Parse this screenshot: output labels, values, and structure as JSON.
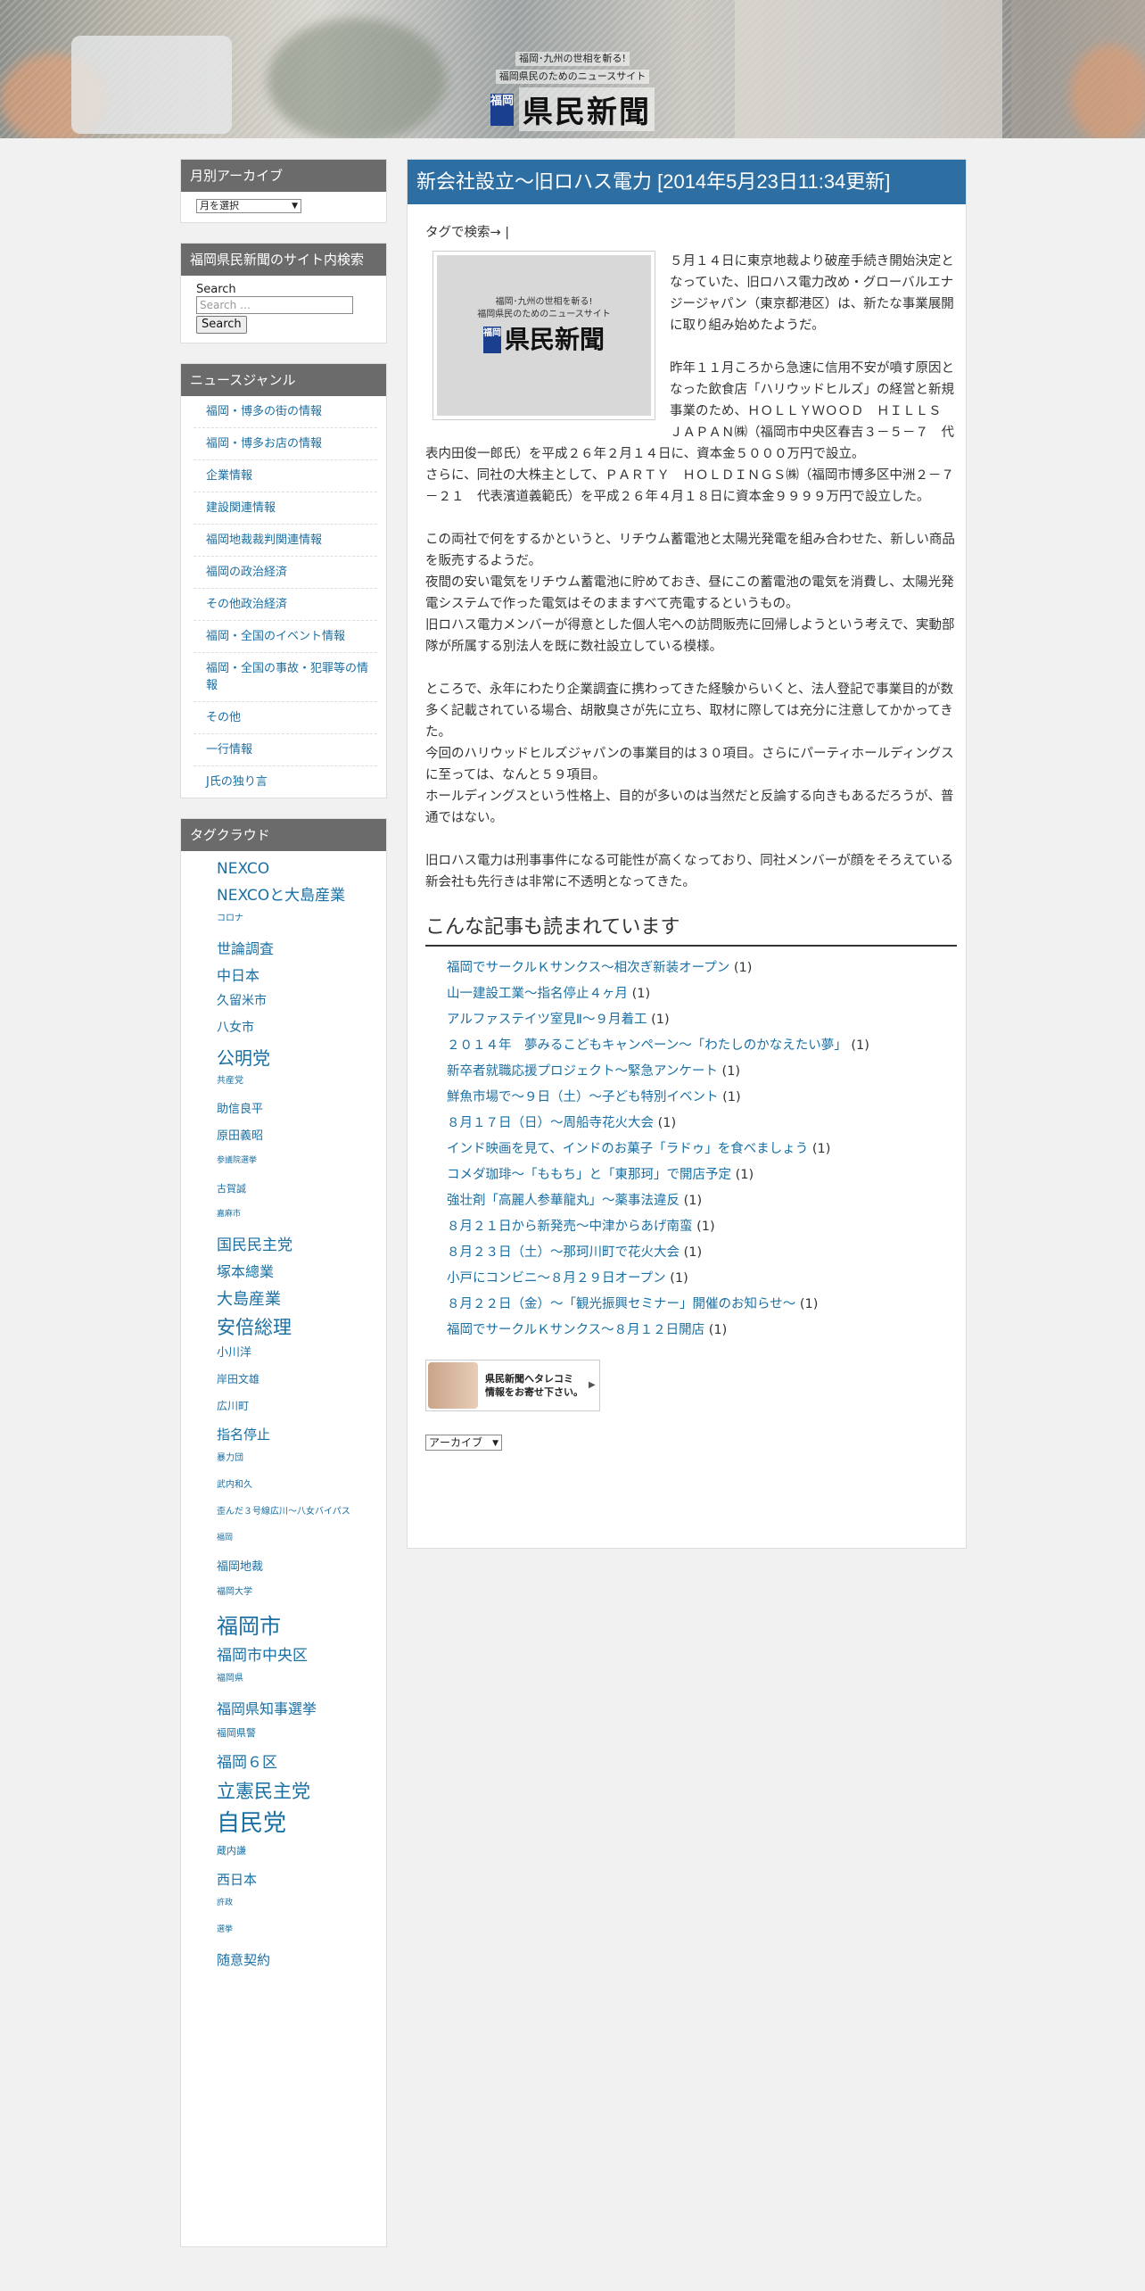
{
  "header": {
    "tagline1": "福岡･九州の世相を斬る!",
    "tagline2": "福岡県民のためのニュースサイト",
    "logo_mark": "福岡",
    "logo_text": "県民新聞"
  },
  "sidebar": {
    "archive": {
      "title": "月別アーカイブ",
      "select_value": "月を選択"
    },
    "search": {
      "title": "福岡県民新聞のサイト内検索",
      "label": "Search",
      "placeholder": "Search …",
      "button": "Search"
    },
    "genre": {
      "title": "ニュースジャンル",
      "items": [
        "福岡・博多の街の情報",
        "福岡・博多お店の情報",
        "企業情報",
        "建設関連情報",
        "福岡地裁裁判関連情報",
        "福岡の政治経済",
        "その他政治経済",
        "福岡・全国のイベント情報",
        "福岡・全国の事故・犯罪等の情報",
        "その他",
        "一行情報",
        "J氏の独り言"
      ]
    },
    "tagcloud": {
      "title": "タグクラウド",
      "tags": [
        {
          "t": "NEXCO",
          "s": 17
        },
        {
          "t": "NEXCOと大島産業",
          "s": 17
        },
        {
          "t": "コロナ",
          "s": 10
        },
        {
          "t": "世論調査",
          "s": 16
        },
        {
          "t": "中日本",
          "s": 16
        },
        {
          "t": "久留米市",
          "s": 14
        },
        {
          "t": "八女市",
          "s": 14
        },
        {
          "t": "公明党",
          "s": 20
        },
        {
          "t": "共産党",
          "s": 10
        },
        {
          "t": "助信良平",
          "s": 13
        },
        {
          "t": "原田義昭",
          "s": 13
        },
        {
          "t": "参議院選挙",
          "s": 9
        },
        {
          "t": "古賀誠",
          "s": 11
        },
        {
          "t": "嘉麻市",
          "s": 9
        },
        {
          "t": "国民民主党",
          "s": 17
        },
        {
          "t": "塚本總業",
          "s": 16
        },
        {
          "t": "大島産業",
          "s": 18
        },
        {
          "t": "安倍総理",
          "s": 21
        },
        {
          "t": "小川洋",
          "s": 13
        },
        {
          "t": "岸田文雄",
          "s": 12
        },
        {
          "t": "広川町",
          "s": 12
        },
        {
          "t": "指名停止",
          "s": 15
        },
        {
          "t": "暴力団",
          "s": 10
        },
        {
          "t": "武内和久",
          "s": 10
        },
        {
          "t": "歪んだ３号線広川～八女バイパス",
          "s": 10
        },
        {
          "t": "福岡",
          "s": 9
        },
        {
          "t": "福岡地裁",
          "s": 13
        },
        {
          "t": "福岡大学",
          "s": 10
        },
        {
          "t": "福岡市",
          "s": 24
        },
        {
          "t": "福岡市中央区",
          "s": 17
        },
        {
          "t": "福岡県",
          "s": 10
        },
        {
          "t": "福岡県知事選挙",
          "s": 16
        },
        {
          "t": "福岡県警",
          "s": 11
        },
        {
          "t": "福岡６区",
          "s": 17
        },
        {
          "t": "立憲民主党",
          "s": 21
        },
        {
          "t": "自民党",
          "s": 26
        },
        {
          "t": "蔵内謙",
          "s": 11
        },
        {
          "t": "西日本",
          "s": 15
        },
        {
          "t": "許政",
          "s": 9
        },
        {
          "t": "選挙",
          "s": 9
        },
        {
          "t": "随意契約",
          "s": 15
        }
      ]
    }
  },
  "post": {
    "title": "新会社設立～旧ロハス電力 [2014年5月23日11:34更新]",
    "tag_search": "タグで検索→ |",
    "thumb": {
      "line1": "福岡･九州の世相を斬る!",
      "line2": "福岡県民のためのニュースサイト",
      "mark": "福岡",
      "text": "県民新聞"
    },
    "paragraphs": [
      "５月１４日に東京地裁より破産手続き開始決定となっていた、旧ロハス電力改め・グローバルエナジージャパン（東京都港区）は、新たな事業展開に取り組み始めたようだ。",
      "昨年１１月ころから急速に信用不安が噴す原因となった飲食店「ハリウッドヒルズ」の経営と新規事業のため、ＨＯＬＬＹＷＯＯＤ　ＨＩＬＬＳ　ＪＡＰＡＮ㈱（福岡市中央区春吉３－５－７　代表内田俊一郎氏）を平成２６年２月１４日に、資本金５０００万円で設立。\nさらに、同社の大株主として、ＰＡＲＴＹ　ＨＯＬＤＩＮＧＳ㈱（福岡市博多区中洲２－７－２１　代表濱道義範氏）を平成２６年４月１８日に資本金９９９９万円で設立した。",
      "この両社で何をするかというと、リチウム蓄電池と太陽光発電を組み合わせた、新しい商品を販売するようだ。\n夜間の安い電気をリチウム蓄電池に貯めておき、昼にこの蓄電池の電気を消費し、太陽光発電システムで作った電気はそのまますべて売電するというもの。\n旧ロハス電力メンバーが得意とした個人宅への訪問販売に回帰しようという考えで、実動部隊が所属する別法人を既に数社設立している模様。",
      "ところで、永年にわたり企業調査に携わってきた経験からいくと、法人登記で事業目的が数多く記載されている場合、胡散臭さが先に立ち、取材に際しては充分に注意してかかってきた。\n今回のハリウッドヒルズジャパンの事業目的は３０項目。さらにパーティホールディングスに至っては、なんと５９項目。\nホールディングスという性格上、目的が多いのは当然だと反論する向きもあるだろうが、普通ではない。",
      "旧ロハス電力は刑事事件になる可能性が高くなっており、同社メンバーが顔をそろえている新会社も先行きは非常に不透明となってきた。"
    ],
    "related_title": "こんな記事も読まれています",
    "related": [
      {
        "t": "福岡でサークルＫサンクス～相次ぎ新装オープン",
        "c": "(1)"
      },
      {
        "t": "山一建設工業～指名停止４ヶ月",
        "c": "(1)"
      },
      {
        "t": "アルファステイツ室見Ⅱ～９月着工",
        "c": "(1)"
      },
      {
        "t": "２０１４年　夢みるこどもキャンペーン～「わたしのかなえたい夢」",
        "c": "(1)"
      },
      {
        "t": "新卒者就職応援プロジェクト～緊急アンケート",
        "c": "(1)"
      },
      {
        "t": "鮮魚市場で～９日（土）～子ども特別イベント",
        "c": "(1)"
      },
      {
        "t": "８月１７日（日）～周船寺花火大会",
        "c": "(1)"
      },
      {
        "t": "インド映画を見て、インドのお菓子「ラドゥ」を食べましょう",
        "c": "(1)"
      },
      {
        "t": "コメダ珈琲～「ももち」と「東那珂」で開店予定",
        "c": "(1)"
      },
      {
        "t": "強壮剤「高麗人参華龍丸」～薬事法違反",
        "c": "(1)"
      },
      {
        "t": "８月２１日から新発売～中津からあげ南蛮",
        "c": "(1)"
      },
      {
        "t": "８月２３日（土）～那珂川町で花火大会",
        "c": "(1)"
      },
      {
        "t": "小戸にコンビニ～８月２９日オープン",
        "c": "(1)"
      },
      {
        "t": "８月２２日（金）～「観光振興セミナー」開催のお知らせ～",
        "c": "(1)"
      },
      {
        "t": "福岡でサークルＫサンクス～８月１２日開店",
        "c": "(1)"
      }
    ],
    "banner": {
      "line1": "県民新聞へタレコミ",
      "line2": "情報をお寄せ下さい。"
    },
    "archive_select": "アーカイブ"
  },
  "colors": {
    "widget_title_bg": "#6b6b6b",
    "post_title_bg": "#2d6ea3",
    "link": "#1a6fa3"
  }
}
